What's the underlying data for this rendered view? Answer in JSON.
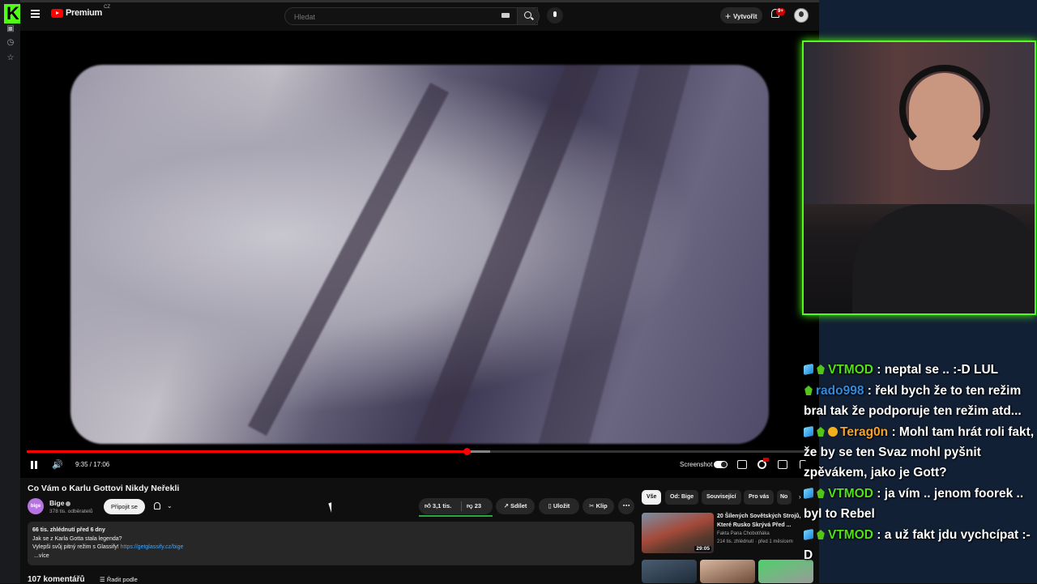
{
  "kick": {
    "logo_letter": "K"
  },
  "youtube": {
    "logo_word": "Premium",
    "logo_region": "CZ",
    "search_placeholder": "Hledat",
    "create_label": "Vytvořit",
    "notification_count": "9+"
  },
  "player": {
    "current_time": "9:35",
    "duration": "17:06",
    "time_display": "9:35 / 17:06",
    "progress_fraction": 0.56,
    "screenshot_label": "Screenshot"
  },
  "video": {
    "title": "Co Vám o Karlu Gottovi Nikdy Neřekli",
    "channel": "Bige",
    "channel_avatar_text": "bige",
    "subscribers": "378 tis. odběratelů",
    "join_label": "Připojit se",
    "likes": "3,1 tis.",
    "dislikes": "23",
    "share_label": "Sdílet",
    "save_label": "Uložit",
    "clip_label": "Klip",
    "views_line": "66 tis. zhlédnutí  před 6 dny",
    "desc_line1": "Jak se z Karla Gotta stala legenda?",
    "desc_line2_prefix": "Vylepši svůj pitný režim s Glassify! ",
    "desc_link": "https://getglassify.cz/bige",
    "desc_more": "...více",
    "comments_count": "107 komentářů",
    "sort_label": "Řadit podle"
  },
  "related": {
    "chips": [
      "Vše",
      "Od: Bige",
      "Související",
      "Pro vás",
      "No"
    ],
    "items": [
      {
        "title": "20 Šílených Sovětských Strojů, Které Rusko Skrývá Před ...",
        "channel": "Fakta Pana Chobotňáka",
        "meta": "214 tis. zhlédnutí · před 1 měsícem",
        "duration": "29:05"
      }
    ]
  },
  "chat": {
    "messages": [
      {
        "user": "VTMOD",
        "badges": [
          "cube-icon",
          "mod-icon"
        ],
        "text": ": neptal se .. :-D LUL",
        "color": "#53e116"
      },
      {
        "user": "rado998",
        "badges": [
          "mod-icon"
        ],
        "text": ": řekl bych že to ten režim bral tak že podporuje ten režim atd...",
        "color": "#2e8bde"
      },
      {
        "user": "Terag0n",
        "badges": [
          "cube-icon",
          "mod-icon",
          "coin-icon"
        ],
        "text": ": Mohl tam hrát roli fakt, že by se ten Svaz mohl pyšnit zpěvákem, jako je Gott?",
        "color": "#f4a32a"
      },
      {
        "user": "VTMOD",
        "badges": [
          "cube-icon",
          "mod-icon"
        ],
        "text": ": ja vím .. jenom foorek .. byl to Rebel",
        "color": "#53e116"
      },
      {
        "user": "VTMOD",
        "badges": [
          "cube-icon",
          "mod-icon"
        ],
        "text": ": a už fakt jdu vychcípat :-D",
        "color": "#53e116"
      }
    ]
  },
  "colors": {
    "kick_green": "#53fc18",
    "youtube_red": "#ff0000",
    "link_blue": "#3ea6ff"
  }
}
